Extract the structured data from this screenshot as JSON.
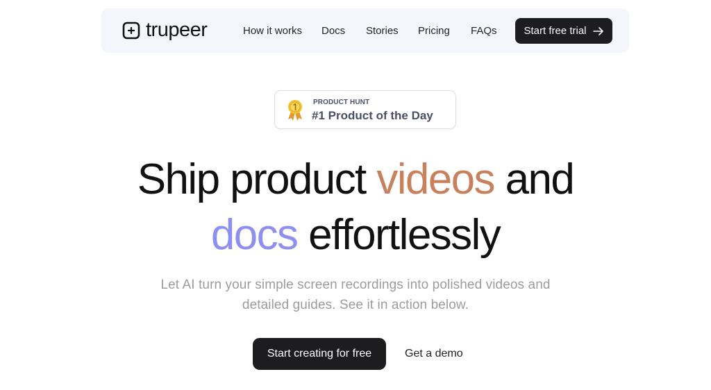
{
  "nav": {
    "logo_text": "trupeer",
    "links": [
      "How it works",
      "Docs",
      "Stories",
      "Pricing",
      "FAQs"
    ],
    "cta_label": "Start free trial"
  },
  "badge": {
    "label_small": "PRODUCT HUNT",
    "label_big": "#1 Product of the Day"
  },
  "hero": {
    "line1_a": "Ship product ",
    "line1_accent": "videos",
    "line1_b": " and",
    "line2_accent": "docs",
    "line2_b": " effortlessly",
    "subtitle_line1": "Let AI turn your simple screen recordings into polished videos and",
    "subtitle_line2": "detailed guides. See it in action below."
  },
  "cta": {
    "primary_label": "Start creating for free",
    "secondary_label": "Get a demo"
  },
  "colors": {
    "accent_videos": "#c7825d",
    "accent_docs": "#8f8ff0",
    "button_dark": "#1d1d1f",
    "nav_bg": "#f5f6fb"
  },
  "icons": [
    "trupeer-logo-icon",
    "arrow-right-icon",
    "medal-icon"
  ]
}
